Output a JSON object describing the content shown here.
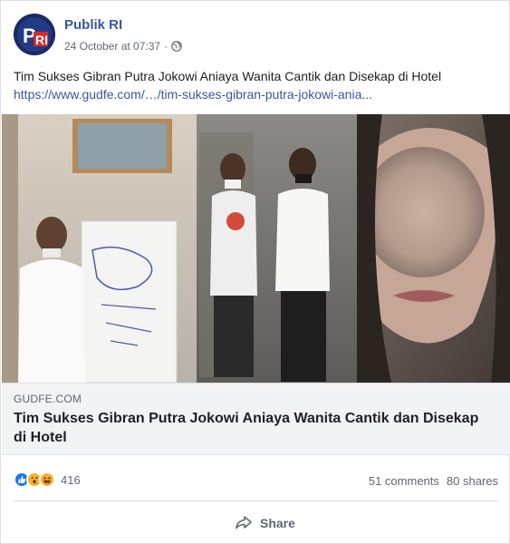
{
  "post": {
    "page_name": "Publik RI",
    "timestamp": "24 October at 07:37",
    "separator": "·",
    "privacy_icon": "globe-icon",
    "text": "Tim Sukses Gibran Putra Jokowi Aniaya Wanita Cantik dan Disekap di Hotel",
    "link": "https://www.gudfe.com/…/tim-sukses-gibran-putra-jokowi-ania..."
  },
  "link_card": {
    "domain": "GUDFE.COM",
    "title": "Tim Sukses Gibran Putra Jokowi Aniaya Wanita Cantik dan Disekap di Hotel"
  },
  "stats": {
    "reaction_icons": [
      "like-icon",
      "wow-icon",
      "haha-icon"
    ],
    "reaction_count": "416",
    "comments": "51 comments",
    "shares": "80 shares"
  },
  "actions": {
    "share_label": "Share",
    "share_icon": "share-arrow-icon"
  },
  "colors": {
    "link_blue": "#385898",
    "like_blue": "#1877f2",
    "emoji_yellow": "#f7b125"
  }
}
